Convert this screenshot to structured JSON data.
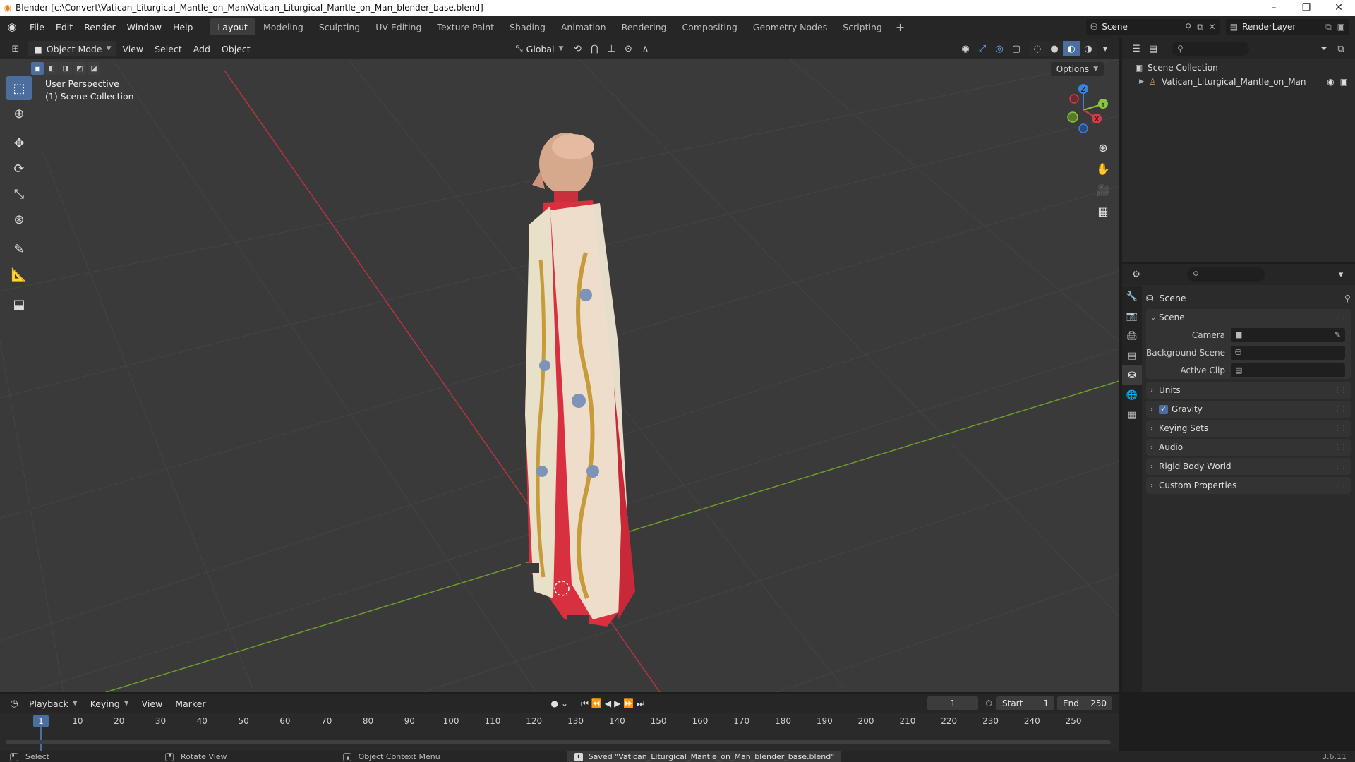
{
  "window": {
    "title": "Blender [c:\\Convert\\Vatican_Liturgical_Mantle_on_Man\\Vatican_Liturgical_Mantle_on_Man_blender_base.blend]",
    "minimize": "–",
    "maximize": "❐",
    "close": "✕"
  },
  "menus": [
    "File",
    "Edit",
    "Render",
    "Window",
    "Help"
  ],
  "workspaces": [
    "Layout",
    "Modeling",
    "Sculpting",
    "UV Editing",
    "Texture Paint",
    "Shading",
    "Animation",
    "Rendering",
    "Compositing",
    "Geometry Nodes",
    "Scripting"
  ],
  "active_workspace": "Layout",
  "scene_selector": {
    "value": "Scene"
  },
  "view_layer": {
    "value": "RenderLayer"
  },
  "viewport": {
    "mode": "Object Mode",
    "menus": [
      "View",
      "Select",
      "Add",
      "Object"
    ],
    "transform_orientation": "Global",
    "options_label": "Options",
    "perspective_label": "User Perspective",
    "collection_label": "(1) Scene Collection",
    "gizmo_axes": {
      "x": "X",
      "y": "Y",
      "z": "Z"
    }
  },
  "outliner": {
    "search_placeholder": "",
    "root": "Scene Collection",
    "item": "Vatican_Liturgical_Mantle_on_Man"
  },
  "properties": {
    "title": "Scene",
    "scene_panel": "Scene",
    "fields": [
      {
        "label": "Camera",
        "value": ""
      },
      {
        "label": "Background Scene",
        "value": ""
      },
      {
        "label": "Active Clip",
        "value": ""
      }
    ],
    "panels": [
      "Units",
      "Gravity",
      "Keying Sets",
      "Audio",
      "Rigid Body World",
      "Custom Properties"
    ],
    "gravity_checked": true
  },
  "timeline": {
    "menus": [
      "Playback",
      "Keying",
      "View",
      "Marker"
    ],
    "current_frame": "1",
    "start_label": "Start",
    "start_value": "1",
    "end_label": "End",
    "end_value": "250",
    "ticks": [
      "1",
      "10",
      "20",
      "30",
      "40",
      "50",
      "60",
      "70",
      "80",
      "90",
      "100",
      "110",
      "120",
      "130",
      "140",
      "150",
      "160",
      "170",
      "180",
      "190",
      "200",
      "210",
      "220",
      "230",
      "240",
      "250"
    ]
  },
  "status": {
    "select": "Select",
    "rotate": "Rotate View",
    "context": "Object Context Menu",
    "message": "Saved \"Vatican_Liturgical_Mantle_on_Man_blender_base.blend\"",
    "version": "3.6.11"
  },
  "colors": {
    "accent": "#4b6e9e",
    "axis_x": "#d93a4a",
    "axis_y": "#8cc63f",
    "axis_z": "#3b82e0",
    "mantle_red": "#d8303f",
    "mantle_cream": "#efe7d2"
  }
}
